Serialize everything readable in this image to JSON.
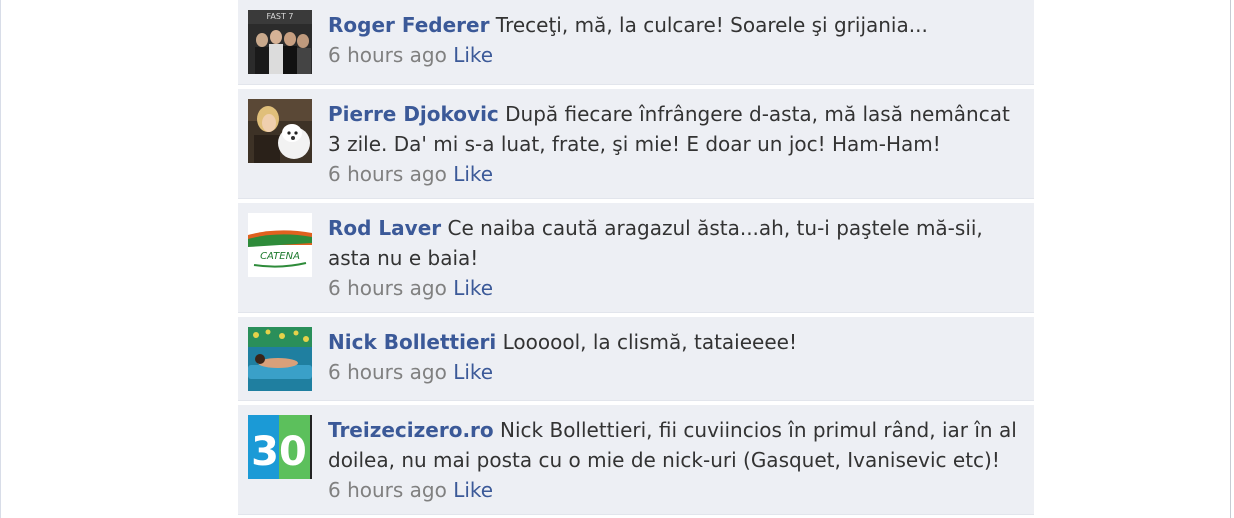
{
  "comments": [
    {
      "author": "Roger Federer",
      "text": "Treceţi, mă, la culcare! Soarele şi grijania...",
      "time": "6 hours ago",
      "like": "Like",
      "avatar_text": "FAST 7"
    },
    {
      "author": "Pierre Djokovic",
      "text": "După fiecare înfrângere d-asta, mă lasă nemâncat 3 zile. Da' mi s-a luat, frate, şi mie! E doar un joc! Ham-Ham!",
      "time": "6 hours ago",
      "like": "Like"
    },
    {
      "author": "Rod Laver",
      "text": "Ce naiba caută aragazul ăsta...ah, tu-i paştele mă-sii, asta nu e baia!",
      "time": "6 hours ago",
      "like": "Like",
      "avatar_text": "CATENA"
    },
    {
      "author": "Nick Bollettieri",
      "text": "Loooool, la clismă, tataieeee!",
      "time": "6 hours ago",
      "like": "Like"
    },
    {
      "author": "Treizecizero.ro",
      "text": "Nick Bollettieri, fii cuviincios în primul rând, iar în al doilea, nu mai posta cu o mie de nick-uri (Gasquet, Ivanisevic etc)!",
      "time": "6 hours ago",
      "like": "Like",
      "avatar_text": "30"
    }
  ]
}
